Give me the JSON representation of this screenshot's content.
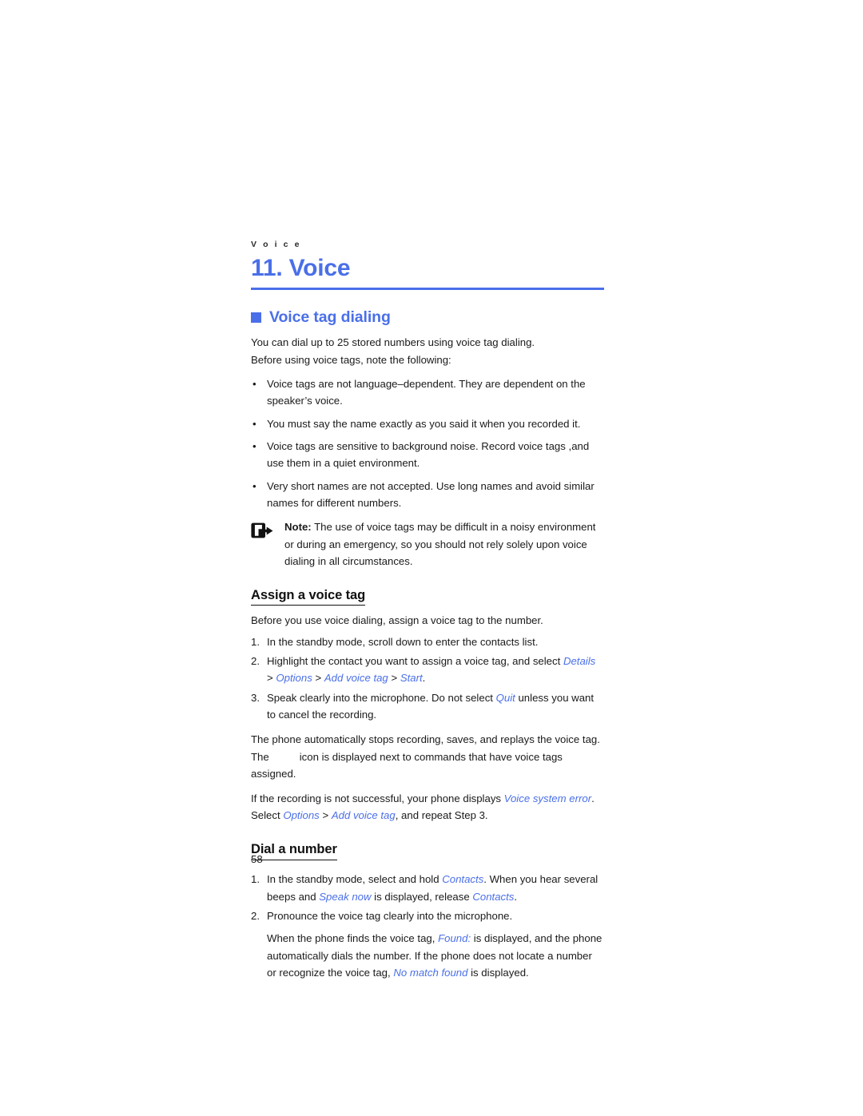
{
  "document": {
    "running_header": "V o i c e",
    "chapter_title": "11. Voice",
    "page_number": "58",
    "accent_color": "#4a6fe8",
    "text_color": "#1a1a1a"
  },
  "section": {
    "heading": "Voice tag dialing",
    "intro": [
      "You can dial up to 25 stored numbers using voice tag dialing.",
      "Before using voice tags, note the following:"
    ],
    "bullets": [
      "Voice tags are not language–dependent. They are dependent on the speaker’s voice.",
      "You must say the name exactly as you said it when you recorded it.",
      "Voice tags are sensitive to background noise. Record voice tags ,and use them in a quiet environment.",
      "Very short names are not accepted. Use long names and avoid similar names for different numbers."
    ],
    "note": {
      "icon": "note-arrow-icon",
      "label": "Note:",
      "text": " The use of voice tags may be difficult in a noisy environment or during an emergency, so you should not rely solely upon voice dialing in all circumstances."
    }
  },
  "assign_voice_tag": {
    "heading": "Assign a voice tag",
    "intro": "Before you use voice dialing, assign a voice tag to the number.",
    "steps": {
      "one": {
        "num": "1.",
        "text": "In the standby mode, scroll down to enter the contacts list."
      },
      "two": {
        "num": "2.",
        "prefix": "Highlight the contact you want to assign a voice tag, and select ",
        "term_details": "Details",
        "sep1": " > ",
        "term_options": "Options",
        "sep2": " > ",
        "term_add_voice_tag": "Add voice tag",
        "sep3": " > ",
        "term_start": "Start",
        "suffix": "."
      },
      "three": {
        "num": "3.",
        "prefix": "Speak clearly into the microphone. Do not select ",
        "term_quit": "Quit",
        "suffix": " unless you want to cancel the recording."
      }
    },
    "after": {
      "line1": "The phone automatically stops recording, saves, and replays the voice tag.",
      "line2_prefix": "The",
      "line2_suffix": "icon is displayed next to commands that have voice tags assigned.",
      "line3_prefix": "If the recording is not successful, your phone displays ",
      "line3_term_error": "Voice system error",
      "line3_mid": ". Select ",
      "line3_term_options": "Options",
      "line3_sep": " > ",
      "line3_term_add": "Add voice tag",
      "line3_suffix": ", and repeat Step 3."
    }
  },
  "dial_a_number": {
    "heading": "Dial a number",
    "steps": {
      "one": {
        "num": "1.",
        "prefix": "In the standby mode, select and hold ",
        "term_contacts1": "Contacts",
        "mid1": ". When you hear several beeps and ",
        "term_speak_now": "Speak now",
        "mid2": " is displayed, release ",
        "term_contacts2": "Contacts",
        "suffix": "."
      },
      "two": {
        "num": "2.",
        "text": "Pronounce the voice tag clearly into the microphone.",
        "sub_prefix": "When the phone finds the voice tag, ",
        "sub_term_found": "Found:",
        "sub_mid": " is displayed, and the phone automatically dials the number. If the phone does not locate a number or recognize the voice tag, ",
        "sub_term_nomatch": "No match found",
        "sub_suffix": " is displayed."
      }
    }
  }
}
